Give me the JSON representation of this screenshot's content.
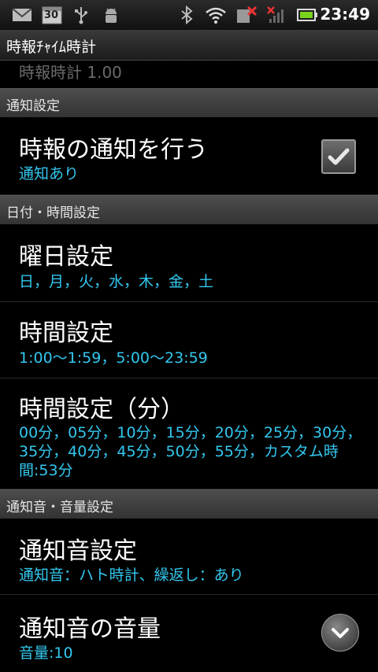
{
  "status_bar": {
    "calendar_badge": "30",
    "time": "23:49",
    "icons": [
      "gmail-icon",
      "calendar-icon",
      "usb-icon",
      "android-debug-icon",
      "bluetooth-icon",
      "wifi-icon",
      "no-sim-icon",
      "no-signal-icon",
      "battery-icon"
    ]
  },
  "app": {
    "title": "時報ﾁｬｲﾑ時計"
  },
  "scrolled_item": {
    "title": "時報時計 1.00"
  },
  "sections": [
    {
      "header": "通知設定"
    },
    {
      "header": "日付・時間設定"
    },
    {
      "header": "通知音・音量設定"
    }
  ],
  "items": {
    "notify": {
      "title": "時報の通知を行う",
      "summary": "通知あり",
      "checked": true
    },
    "weekday": {
      "title": "曜日設定",
      "summary": "日，月，火，水，木，金，土"
    },
    "hours": {
      "title": "時間設定",
      "summary": "1:00〜1:59，5:00〜23:59"
    },
    "minutes": {
      "title": "時間設定（分）",
      "summary": "00分，05分，10分，15分，20分，25分，30分，35分，40分，45分，50分，55分，カスタム時間:53分"
    },
    "sound": {
      "title": "通知音設定",
      "summary": "通知音：ハト時計、繰返し：あり"
    },
    "volume": {
      "title": "通知音の音量",
      "summary": "音量:10"
    }
  },
  "colors": {
    "summary": "#33c8f0",
    "section_bg": "#404040",
    "background": "#000000"
  }
}
